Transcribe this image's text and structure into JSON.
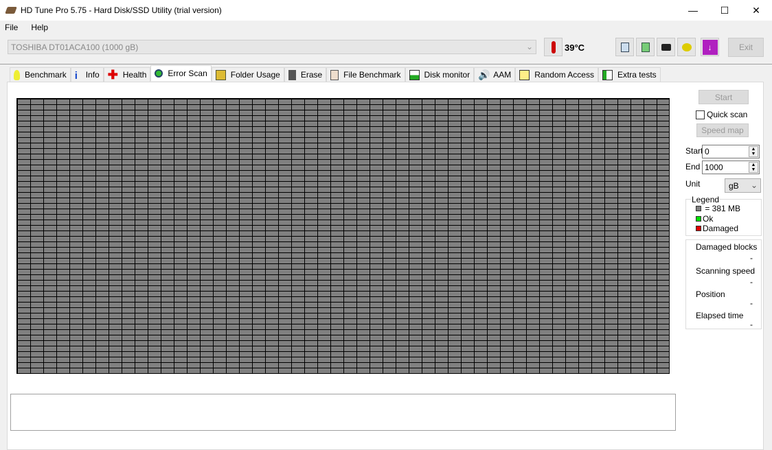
{
  "window": {
    "title": "HD Tune Pro 5.75 - Hard Disk/SSD Utility (trial version)",
    "min": "—",
    "max": "☐",
    "close": "✕"
  },
  "menu": {
    "file": "File",
    "help": "Help"
  },
  "toolbar": {
    "drive": "TOSHIBA DT01ACA100 (1000 gB)",
    "temperature": "39°C",
    "exit": "Exit"
  },
  "tabs": [
    "Benchmark",
    "Info",
    "Health",
    "Error Scan",
    "Folder Usage",
    "Erase",
    "File Benchmark",
    "Disk monitor",
    "AAM",
    "Random Access",
    "Extra tests"
  ],
  "active_tab": "Error Scan",
  "side": {
    "start_button": "Start",
    "quick_scan": "Quick scan",
    "quick_scan_checked": false,
    "speed_map": "Speed map",
    "start_label": "Start",
    "start_value": "0",
    "end_label": "End",
    "end_value": "1000",
    "unit_label": "Unit",
    "unit_value": "gB",
    "legend_title": "Legend",
    "legend_block": "= 381 MB",
    "legend_ok": "Ok",
    "legend_damaged": "Damaged",
    "stats": [
      {
        "label": "Damaged blocks",
        "value": "-"
      },
      {
        "label": "Scanning speed",
        "value": "-"
      },
      {
        "label": "Position",
        "value": "-"
      },
      {
        "label": "Elapsed time",
        "value": "-"
      }
    ]
  },
  "colors": {
    "block": "#808080",
    "ok": "#00e000",
    "damaged": "#e00000"
  },
  "grid": {
    "columns": 50,
    "rows": 50
  }
}
